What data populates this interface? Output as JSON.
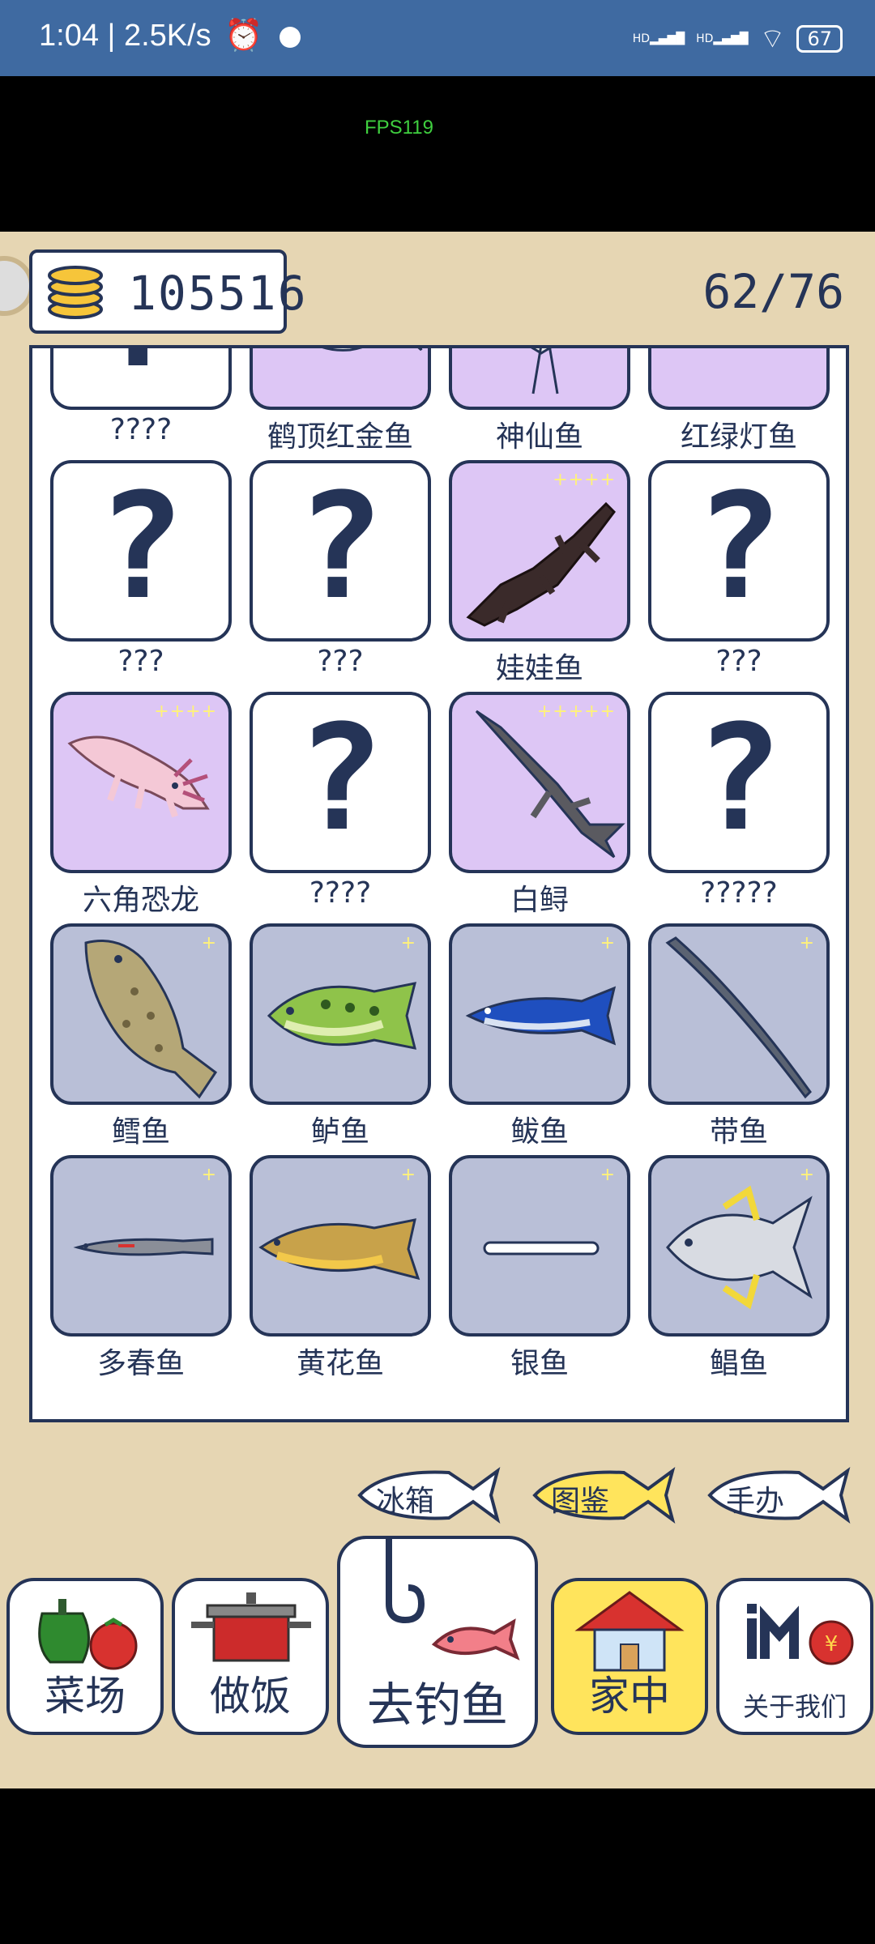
{
  "status_bar": {
    "time_speed": "1:04 | 2.5K/s",
    "network_1": "HD",
    "network_2": "HD",
    "battery": "67"
  },
  "overlay": {
    "fps": "FPS119"
  },
  "header": {
    "coins": "105516",
    "progress": "62/76"
  },
  "fish_rows": [
    [
      {
        "name": "????",
        "state": "unknown",
        "stars": ""
      },
      {
        "name": "鹤顶红金鱼",
        "state": "rare",
        "stars": "",
        "icon": "goldfish-icon"
      },
      {
        "name": "神仙鱼",
        "state": "rare",
        "stars": "",
        "icon": "angelfish-icon"
      },
      {
        "name": "红绿灯鱼",
        "state": "rare",
        "stars": "",
        "icon": "neon-tetra-icon"
      }
    ],
    [
      {
        "name": "???",
        "state": "unknown",
        "stars": ""
      },
      {
        "name": "???",
        "state": "unknown",
        "stars": ""
      },
      {
        "name": "娃娃鱼",
        "state": "rare",
        "stars": "++++",
        "icon": "giant-salamander-icon"
      },
      {
        "name": "???",
        "state": "unknown",
        "stars": ""
      }
    ],
    [
      {
        "name": "六角恐龙",
        "state": "rare",
        "stars": "++++",
        "icon": "axolotl-icon"
      },
      {
        "name": "????",
        "state": "unknown",
        "stars": ""
      },
      {
        "name": "白鲟",
        "state": "rare",
        "stars": "+++++",
        "icon": "paddlefish-icon"
      },
      {
        "name": "?????",
        "state": "unknown",
        "stars": ""
      }
    ],
    [
      {
        "name": "鳕鱼",
        "state": "normal",
        "stars": "+",
        "icon": "cod-icon"
      },
      {
        "name": "鲈鱼",
        "state": "normal",
        "stars": "+",
        "icon": "bass-icon"
      },
      {
        "name": "鲅鱼",
        "state": "normal",
        "stars": "+",
        "icon": "mackerel-icon"
      },
      {
        "name": "带鱼",
        "state": "normal",
        "stars": "+",
        "icon": "hairtail-icon"
      }
    ],
    [
      {
        "name": "多春鱼",
        "state": "normal",
        "stars": "+",
        "icon": "capelin-icon"
      },
      {
        "name": "黄花鱼",
        "state": "normal",
        "stars": "+",
        "icon": "yellow-croaker-icon"
      },
      {
        "name": "银鱼",
        "state": "normal",
        "stars": "+",
        "icon": "whitebait-icon"
      },
      {
        "name": "鲳鱼",
        "state": "normal",
        "stars": "+",
        "icon": "pomfret-icon"
      }
    ]
  ],
  "sub_tabs": {
    "fridge": "冰箱",
    "collection": "图鉴",
    "figures": "手办"
  },
  "bottom_nav": {
    "garden": "菜场",
    "cook": "做饭",
    "fishing": "去钓鱼",
    "home": "家中",
    "about": "关于我们"
  },
  "colors": {
    "ink": "#253457",
    "rare_bg": "#ddc6f5",
    "normal_bg": "#b9bfd7",
    "active": "#ffe45c",
    "sand": "#e6d6b3"
  }
}
